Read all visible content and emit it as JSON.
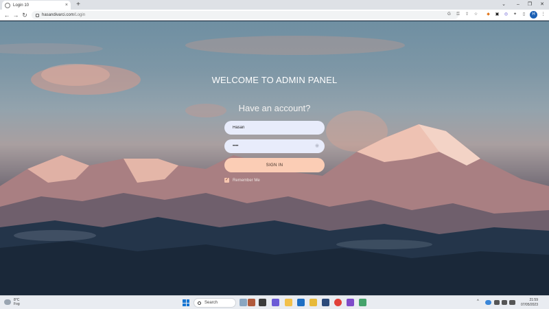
{
  "browser": {
    "tab_title": "Login 10",
    "tab_close": "×",
    "new_tab": "+",
    "window_controls": {
      "minimize": "–",
      "restore": "❐",
      "close": "✕",
      "chevron": "⌄"
    },
    "nav": {
      "back": "←",
      "forward": "→",
      "reload": "↻"
    },
    "url_domain": "hasandivarci.com",
    "url_path": "/Login",
    "extensions": [
      "G",
      "⚿",
      "⇪",
      "☆",
      "◆",
      "▣",
      "◎",
      "✦",
      "▯"
    ],
    "profile_initial": "H",
    "menu": "⋮"
  },
  "login": {
    "welcome": "WELCOME TO ADMIN PANEL",
    "have_account": "Have an account?",
    "username_value": "Hasan",
    "password_value": "••••",
    "sign_in_label": "SIGN IN",
    "remember_label": "Remember Me",
    "remember_checked": true,
    "check_glyph": "✓",
    "eye_glyph": "◉"
  },
  "taskbar": {
    "weather_temp": "8°C",
    "weather_desc": "Fog",
    "search_label": "Search",
    "tray_up": "^",
    "time": "21:59",
    "date": "07/05/2023"
  },
  "colors": {
    "sign_in_bg": "#fbcdb5",
    "field_bg": "#e8ecfb",
    "profile": "#1a5fb4",
    "start": "#1976d2"
  }
}
